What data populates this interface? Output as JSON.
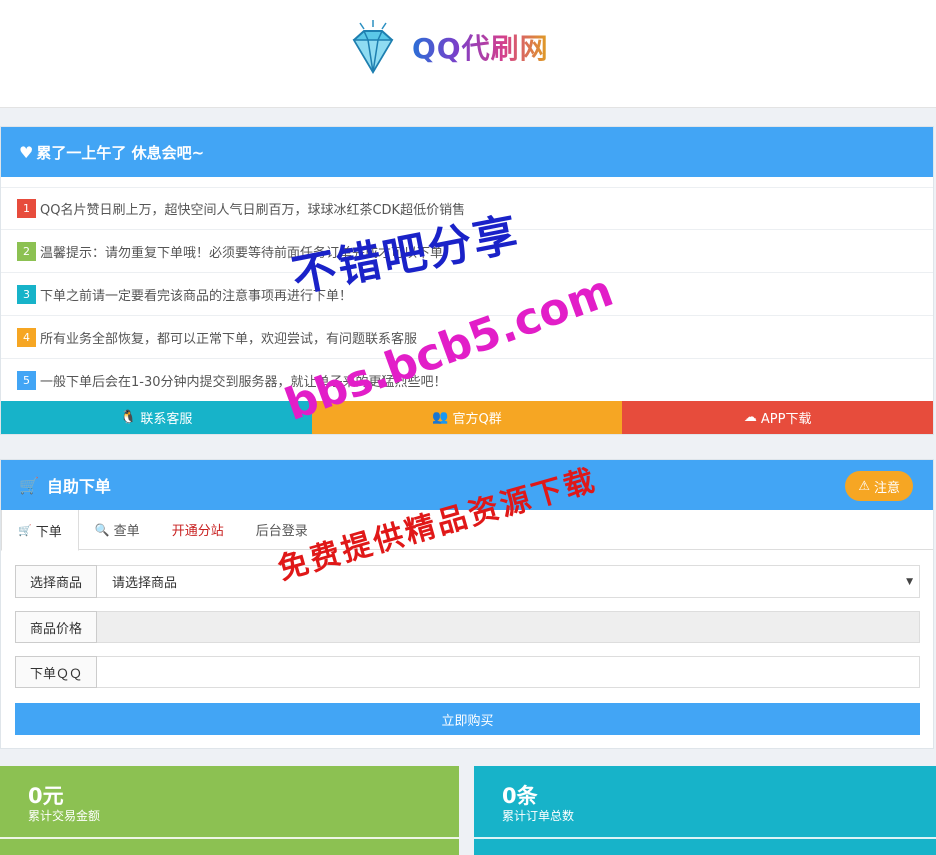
{
  "header": {
    "logo_text": "QQ代刷网"
  },
  "notice": {
    "title": "累了一上午了 休息会吧~",
    "items": [
      {
        "num": "1",
        "color": "#e74c3c",
        "text": "QQ名片赞日刷上万，超快空间人气日刷百万，球球冰红茶CDK超低价销售"
      },
      {
        "num": "2",
        "color": "#8cc152",
        "text": "温馨提示：请勿重复下单哦！必须要等待前面任务订单完成才可以下单！"
      },
      {
        "num": "3",
        "color": "#17b3c9",
        "text": "下单之前请一定要看完该商品的注意事项再进行下单！"
      },
      {
        "num": "4",
        "color": "#f6a623",
        "text": "所有业务全部恢复，都可以正常下单，欢迎尝试，有问题联系客服"
      },
      {
        "num": "5",
        "color": "#42a5f5",
        "text": "一般下单后会在1-30分钟内提交到服务器，就让单子来的更猛烈些吧！"
      }
    ],
    "buttons": [
      {
        "label": "联系客服",
        "icon": "qq-icon",
        "color": "#17b3c9"
      },
      {
        "label": "官方Q群",
        "icon": "users-icon",
        "color": "#f6a623"
      },
      {
        "label": "APP下载",
        "icon": "cloud-download-icon",
        "color": "#e74c3c"
      }
    ]
  },
  "order": {
    "title": "自助下单",
    "warn_label": "注意",
    "tabs": [
      {
        "label": "下单",
        "icon": "cart-icon"
      },
      {
        "label": "查单",
        "icon": "search-icon"
      },
      {
        "label": "开通分站"
      },
      {
        "label": "后台登录"
      }
    ],
    "fields": {
      "product_label": "选择商品",
      "product_value": "请选择商品",
      "price_label": "商品价格",
      "price_value": "",
      "qq_label": "下单ＱＱ",
      "qq_value": ""
    },
    "buy_label": "立即购买"
  },
  "stats": [
    {
      "value": "0元",
      "label": "累计交易金额",
      "color": "#8cc152"
    },
    {
      "value": "0条",
      "label": "累计订单总数",
      "color": "#17b3c9"
    }
  ],
  "watermark": {
    "line1": "不错吧分享",
    "line2": "bbs.bcb5.com",
    "line3": "免费提供精品资源下载"
  }
}
